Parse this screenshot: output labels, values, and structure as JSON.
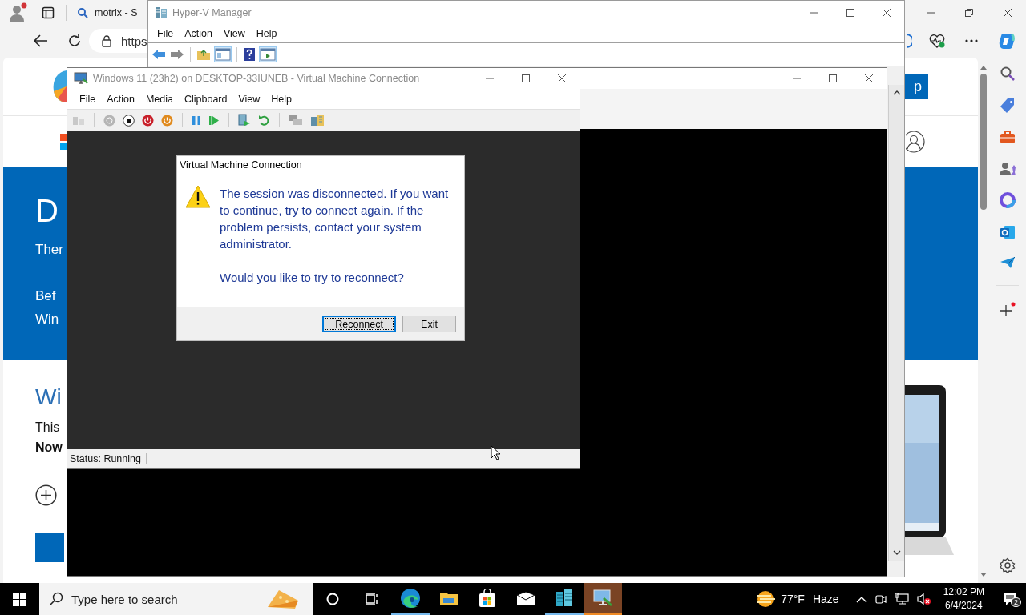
{
  "browser": {
    "tab_title": "motrix - S",
    "address": "https",
    "page": {
      "header_button": "p",
      "banner_heading": "D",
      "banner_lines": [
        "Ther",
        "Bef",
        "Win"
      ],
      "section_heading": "Wi",
      "body_line": "This",
      "body_bold": "Now"
    }
  },
  "hyperv_manager": {
    "title": "Hyper-V Manager",
    "menu": [
      "File",
      "Action",
      "View",
      "Help"
    ]
  },
  "vm_window": {
    "title": "Windows  11 (23h2) on DESKTOP-33IUNEB - Virtual Machine Connection",
    "menu": [
      "File",
      "Action",
      "Media",
      "Clipboard",
      "View",
      "Help"
    ],
    "status": "Status: Running"
  },
  "dialog": {
    "title": "Virtual Machine Connection",
    "message": "The session was disconnected. If you want to continue, try to connect again. If the problem persists, contact your system administrator.",
    "question": "Would you like to try to reconnect?",
    "buttons": [
      {
        "label": "Reconnect",
        "selected": true
      },
      {
        "label": "Exit",
        "selected": false
      }
    ]
  },
  "taskbar": {
    "search_placeholder": "Type here to search",
    "apps": [
      {
        "kind": "edge",
        "running": true,
        "selected": false
      },
      {
        "kind": "explorer",
        "running": false,
        "selected": false
      },
      {
        "kind": "store",
        "running": false,
        "selected": false
      },
      {
        "kind": "mail",
        "running": false,
        "selected": false
      },
      {
        "kind": "hyperv",
        "running": true,
        "selected": false
      },
      {
        "kind": "vmconnect",
        "running": true,
        "selected": true
      }
    ],
    "temperature": "77°F",
    "condition": "Haze",
    "volume_muted": true,
    "time": "12:02 PM",
    "date": "6/4/2024",
    "notifications": "2"
  }
}
